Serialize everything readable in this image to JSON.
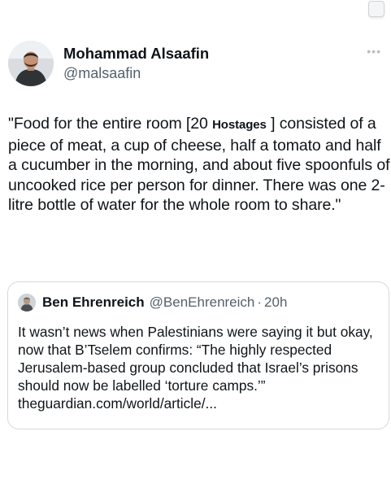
{
  "tweet": {
    "author_name": "Mohammad Alsaafin",
    "author_handle": "@malsaafin",
    "text_start": "\"Food for the entire room [20 ",
    "tag_label": "Hostages",
    "text_end": " ] consisted of a piece of meat, a cup of cheese, half a tomato and half a cucumber in the morning, and about five spoonfuls of uncooked rice per person for dinner. There was one 2-litre bottle of water for the whole room to share.\""
  },
  "quoted_tweet": {
    "author_name": "Ben Ehrenreich",
    "author_handle": "@BenEhrenreich",
    "separator": "·",
    "time": "20h",
    "text": "It wasn’t news when Palestinians were saying it but okay, now that B’Tselem confirms: “The highly respected Jerusalem-based group concluded that Israel’s prisons should now be labelled ‘torture camps.’” theguardian.com/world/article/..."
  },
  "icons": {
    "more": "more-options-icon",
    "avatar": "avatar-photo",
    "corner": "copy-square-icon"
  }
}
